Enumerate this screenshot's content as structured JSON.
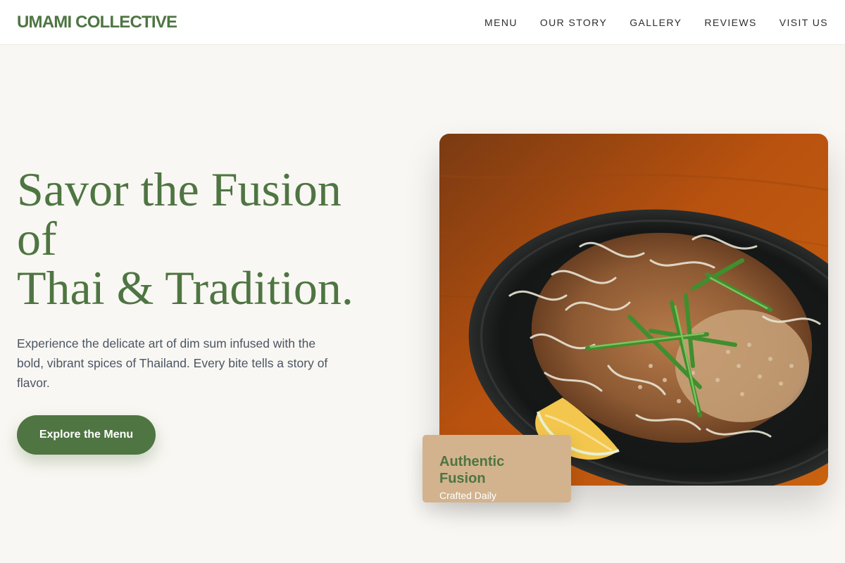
{
  "brand": {
    "name": "UMAMI COLLECTIVE",
    "accent": "#4e7542",
    "sand": "#d2b38d",
    "background": "#f9f7f3"
  },
  "nav": {
    "items": [
      {
        "label": "MENU"
      },
      {
        "label": "OUR STORY"
      },
      {
        "label": "GALLERY"
      },
      {
        "label": "REVIEWS"
      },
      {
        "label": "VISIT US"
      }
    ]
  },
  "hero": {
    "title_lines": [
      "Savor the Fusion",
      "of",
      "Thai & Tradition."
    ],
    "text": "Experience the delicate art of dim sum infused with the bold, vibrant spices of Thailand. Every bite tells a story of flavor.",
    "cta_label": "Explore the Menu",
    "image": {
      "icon": "pad-thai-photo"
    }
  },
  "badge": {
    "title": "Authentic Fusion",
    "subtitle": "Crafted Daily"
  }
}
